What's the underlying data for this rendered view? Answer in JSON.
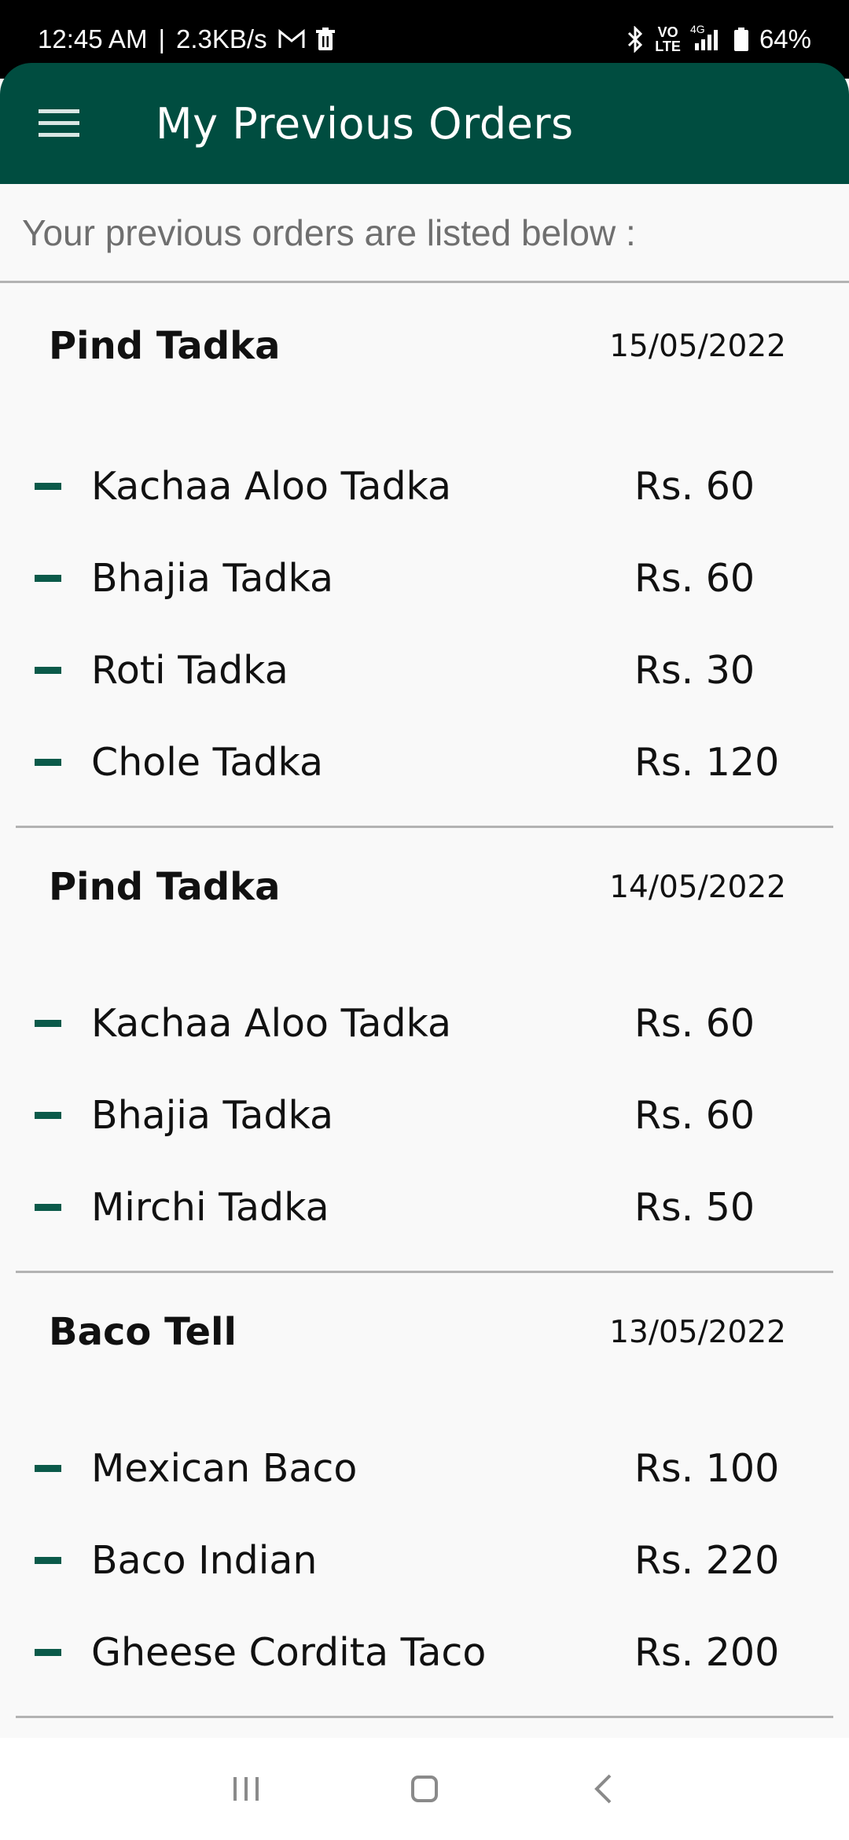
{
  "status_bar": {
    "time": "12:45 AM",
    "separator": "|",
    "network_speed": "2.3KB/s",
    "volte_top": "VO",
    "volte_bottom": "LTE",
    "network_type": "4G",
    "battery": "64%"
  },
  "app_bar": {
    "title": "My Previous Orders",
    "icons": [
      "menu-icon"
    ]
  },
  "subheader": "Your previous orders are listed below :",
  "orders": [
    {
      "restaurant": "Pind Tadka",
      "date": "15/05/2022",
      "items": [
        {
          "name": "Kachaa Aloo Tadka",
          "price": "Rs. 60"
        },
        {
          "name": "Bhajia Tadka",
          "price": "Rs. 60"
        },
        {
          "name": "Roti Tadka",
          "price": "Rs. 30"
        },
        {
          "name": "Chole Tadka",
          "price": "Rs. 120"
        }
      ]
    },
    {
      "restaurant": "Pind Tadka",
      "date": "14/05/2022",
      "items": [
        {
          "name": "Kachaa Aloo Tadka",
          "price": "Rs. 60"
        },
        {
          "name": "Bhajia Tadka",
          "price": "Rs. 60"
        },
        {
          "name": "Mirchi Tadka",
          "price": "Rs. 50"
        }
      ]
    },
    {
      "restaurant": "Baco Tell",
      "date": "13/05/2022",
      "items": [
        {
          "name": "Mexican Baco",
          "price": "Rs. 100"
        },
        {
          "name": "Baco Indian",
          "price": "Rs. 220"
        },
        {
          "name": "Gheese Cordita Taco",
          "price": "Rs. 200"
        }
      ]
    }
  ],
  "nav_bar": {
    "icons": [
      "recent-apps-icon",
      "home-icon",
      "back-icon"
    ]
  },
  "colors": {
    "app_bar": "#004d40",
    "bullet": "#0b5a4a",
    "background": "#f9f9f9"
  }
}
